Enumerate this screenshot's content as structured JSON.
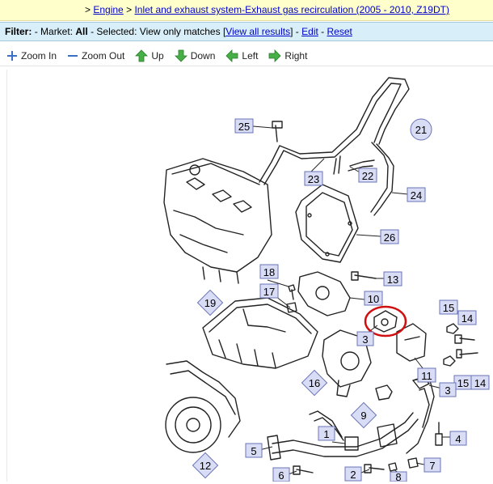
{
  "breadcrumb": {
    "sep1": ">",
    "item1": "Engine",
    "sep2": ">",
    "item2": "Inlet and exhaust system-Exhaust gas recirculation (2005 - 2010, Z19DT)"
  },
  "filter": {
    "label": "Filter:",
    "market_prefix": "- Market:",
    "market_value": "All",
    "selected_prefix": "- Selected:",
    "selected_value": "View only matches",
    "view_all_link": "View all results",
    "edit_link": "Edit",
    "reset_link": "Reset",
    "bracket_open": "[",
    "bracket_close": "]",
    "dash": "-"
  },
  "toolbar": {
    "zoom_in": "Zoom In",
    "zoom_out": "Zoom Out",
    "up": "Up",
    "down": "Down",
    "left": "Left",
    "right": "Right"
  },
  "colors": {
    "crumb_bg": "#ffffcc",
    "filter_bg": "#d8eef8",
    "link": "#0000cc",
    "callout_fill": "#d8dcf4",
    "callout_stroke": "#6a74b8",
    "highlight_ring": "#d01010",
    "arrow_green": "#3aa33a"
  },
  "callouts": {
    "c1": "1",
    "c2": "2",
    "c3a": "3",
    "c3b": "3",
    "c4": "4",
    "c5": "5",
    "c6": "6",
    "c7": "7",
    "c8": "8",
    "c9": "9",
    "c10": "10",
    "c11": "11",
    "c12": "12",
    "c13": "13",
    "c14a": "14",
    "c14b": "14",
    "c15a": "15",
    "c15b": "15",
    "c16": "16",
    "c17": "17",
    "c18": "18",
    "c19": "19",
    "c21": "21",
    "c22": "22",
    "c23": "23",
    "c24": "24",
    "c25": "25",
    "c26": "26"
  }
}
